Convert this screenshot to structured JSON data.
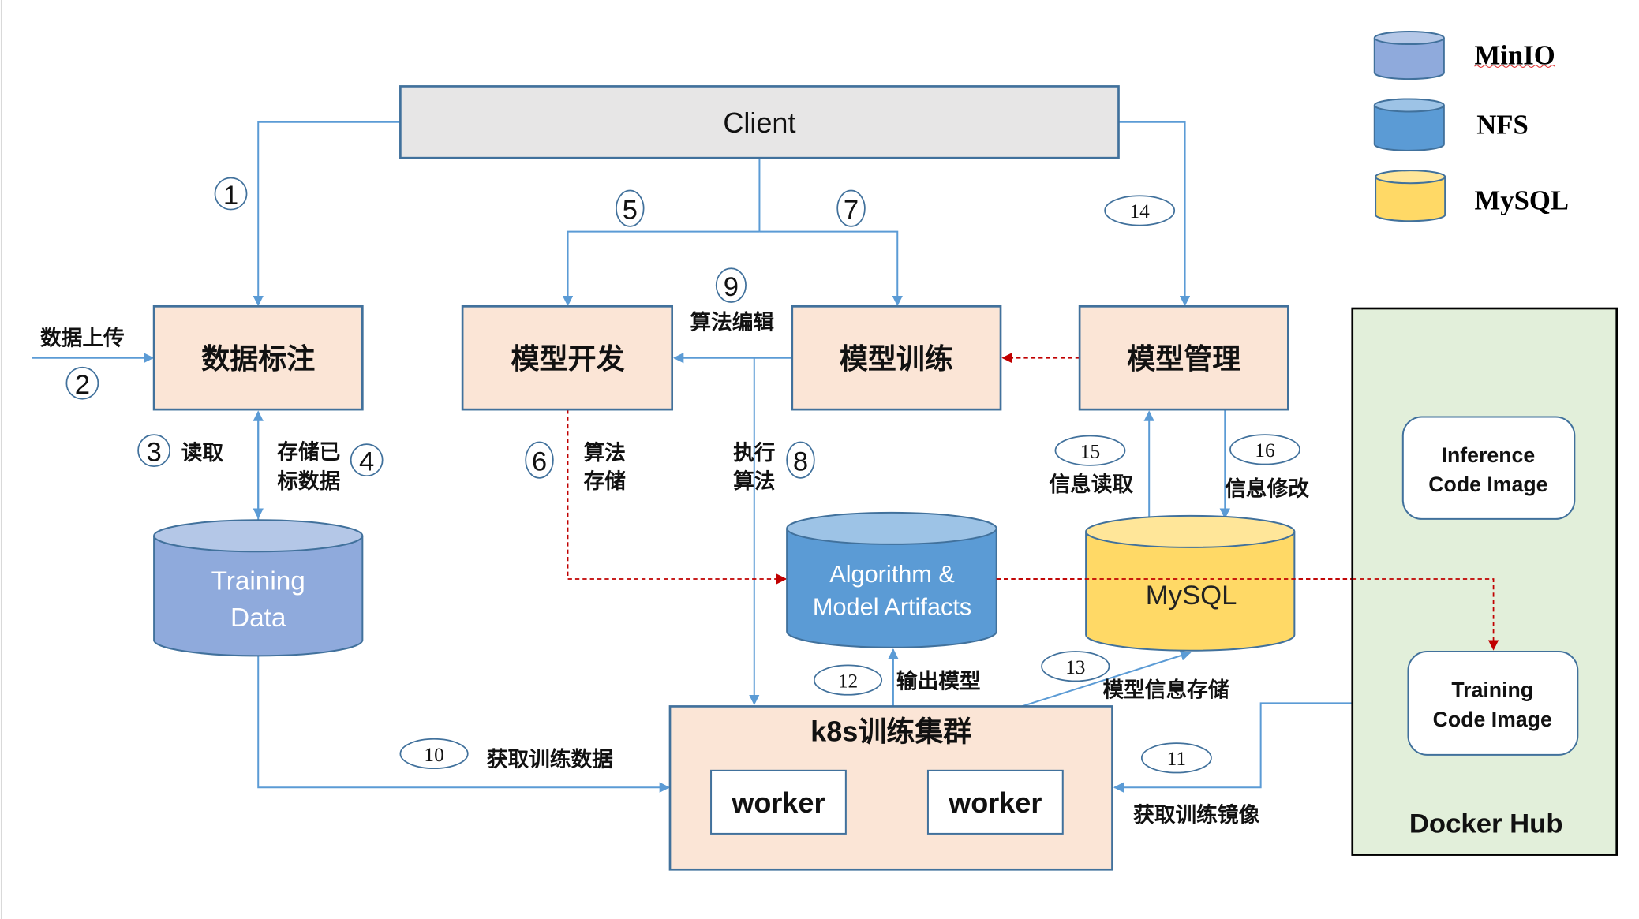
{
  "legend": [
    {
      "label": "MinIO",
      "color": "#8faadc",
      "top_color": "#b4c7e7"
    },
    {
      "label": "NFS",
      "color": "#5b9bd5",
      "top_color": "#9dc3e6"
    },
    {
      "label": "MySQL",
      "color": "#ffd966",
      "top_color": "#ffe699"
    }
  ],
  "client": {
    "label": "Client"
  },
  "modules": {
    "data_labeling": "数据标注",
    "model_dev": "模型开发",
    "model_training": "模型训练",
    "model_mgmt": "模型管理"
  },
  "stores": {
    "training_data": {
      "line1": "Training",
      "line2": "Data"
    },
    "artifacts": {
      "line1": "Algorithm &",
      "line2": "Model Artifacts"
    },
    "mysql": {
      "label": "MySQL"
    }
  },
  "cluster": {
    "title": "k8s训练集群",
    "workers": [
      "worker",
      "worker"
    ]
  },
  "docker_hub": {
    "title": "Docker Hub",
    "inference": {
      "line1": "Inference",
      "line2": "Code Image"
    },
    "training": {
      "line1": "Training",
      "line2": "Code Image"
    }
  },
  "steps": {
    "s1": "1",
    "s2": "2",
    "s3": "3",
    "s4": "4",
    "s5": "5",
    "s6": "6",
    "s7": "7",
    "s8": "8",
    "s9": "9",
    "s10": "10",
    "s11": "11",
    "s12": "12",
    "s13": "13",
    "s14": "14",
    "s15": "15",
    "s16": "16"
  },
  "edge_labels": {
    "upload": "数据上传",
    "read": "读取",
    "store_labeled_1": "存储已",
    "store_labeled_2": "标数据",
    "algo_store_1": "算法",
    "algo_store_2": "存储",
    "exec_algo_1": "执行",
    "exec_algo_2": "算法",
    "algo_edit": "算法编辑",
    "info_read": "信息读取",
    "info_modify": "信息修改",
    "output_model": "输出模型",
    "model_info_store": "模型信息存储",
    "fetch_data": "获取训练数据",
    "fetch_image": "获取训练镜像"
  },
  "colors": {
    "process_fill": "#fbe5d6",
    "process_stroke": "#41719c",
    "client_fill": "#e7e6e6",
    "docker_fill": "#e2efda",
    "flow_line": "#5b9bd5",
    "dashed_line": "#c00000"
  }
}
